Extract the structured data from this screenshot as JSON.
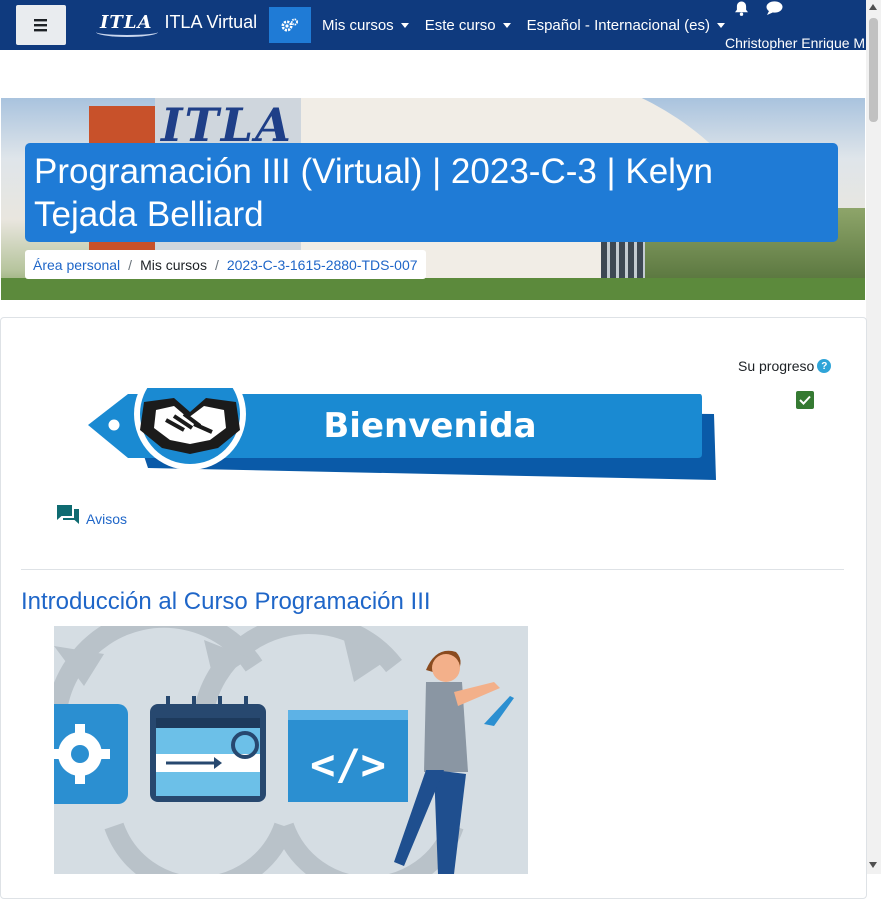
{
  "navbar": {
    "brand_logo": "ITLA",
    "site_name": "ITLA Virtual",
    "menu": [
      {
        "label": "Mis cursos"
      },
      {
        "label": "Este curso"
      },
      {
        "label": "Español - Internacional (es)"
      }
    ],
    "user_name": "Christopher Enrique M"
  },
  "banner": {
    "building_logo": "ITLA"
  },
  "course": {
    "title": "Programación III (Virtual) | 2023-C-3 | Kelyn Tejada Belliard",
    "breadcrumb": [
      "Área personal",
      "Mis cursos",
      "2023-C-3-1615-2880-TDS-007"
    ]
  },
  "progress": {
    "label": "Su progreso",
    "help": "?"
  },
  "welcome_banner": {
    "text": "Bienvenida"
  },
  "activities": [
    {
      "label": "Avisos",
      "icon": "forum-icon"
    }
  ],
  "sections": [
    {
      "title": "Introducción al Curso Programación III"
    }
  ],
  "colors": {
    "navbar": "#0f3a7e",
    "primary": "#1f7bd6",
    "link": "#1f66c8",
    "success": "#357a32",
    "forum_icon": "#0f6b71"
  }
}
